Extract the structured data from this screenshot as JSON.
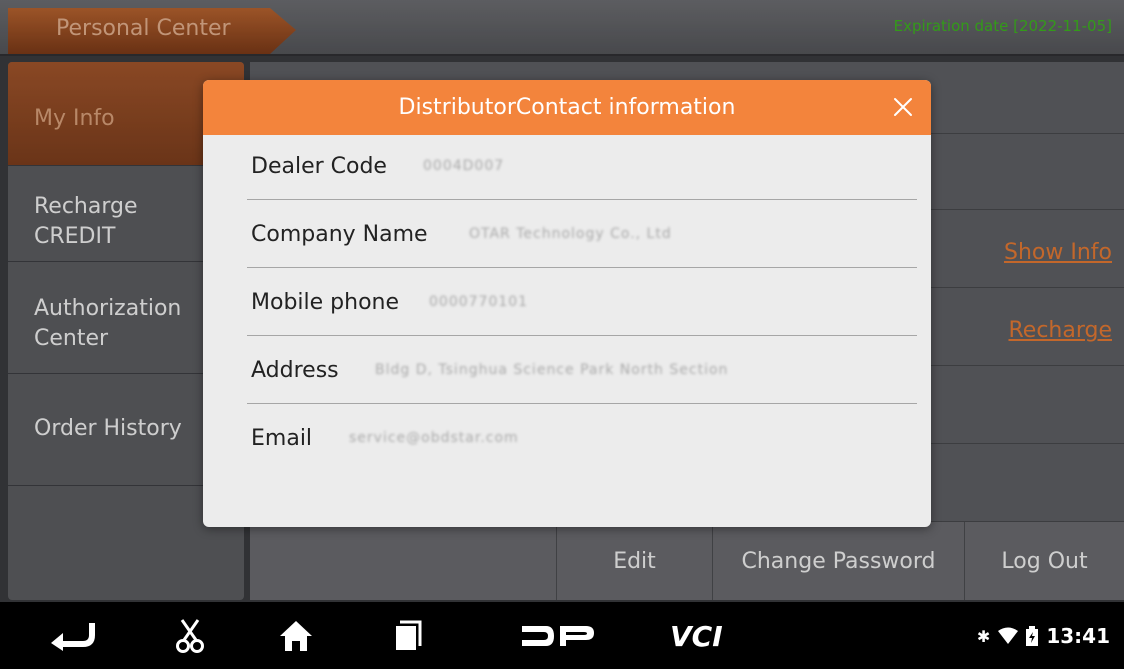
{
  "header": {
    "tab_title": "Personal Center",
    "expiry": "Expiration date [2022-11-05]"
  },
  "sidebar": {
    "items": [
      {
        "label": "My Info",
        "active": true
      },
      {
        "label": "Recharge\nCREDIT"
      },
      {
        "label": "Authorization\nCenter"
      },
      {
        "label": "Order History"
      }
    ]
  },
  "main": {
    "show_info_link": "Show Info",
    "recharge_link": "Recharge",
    "buttons": {
      "edit": "Edit",
      "change_password": "Change Password",
      "log_out": "Log Out"
    }
  },
  "modal": {
    "title": "DistributorContact information",
    "rows": [
      {
        "label": "Dealer Code",
        "value": "0004D007"
      },
      {
        "label": "Company Name",
        "value": "OTAR Technology Co., Ltd"
      },
      {
        "label": "Mobile phone",
        "value": "0000770101"
      },
      {
        "label": "Address",
        "value": "Bldg D, Tsinghua Science Park North Section"
      },
      {
        "label": "Email",
        "value": "service@obdstar.com"
      }
    ]
  },
  "navbar": {
    "time": "13:41",
    "icons": [
      "back-icon",
      "scissors-icon",
      "home-icon",
      "recent-apps-icon",
      "dp-logo-icon",
      "vci-icon",
      "bluetooth-icon",
      "wifi-icon",
      "battery-icon"
    ]
  },
  "colors": {
    "accent": "#f3843c",
    "link": "#e67a33",
    "expiry": "#3db51e"
  }
}
